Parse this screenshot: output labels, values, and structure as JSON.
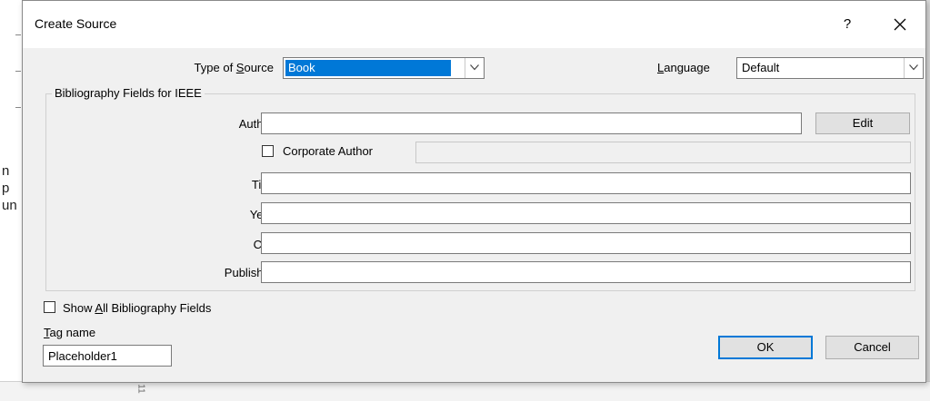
{
  "dialog": {
    "title": "Create Source",
    "help_label": "?",
    "close_label": "✕"
  },
  "source_type": {
    "label_pre": "Type of ",
    "label_mn": "S",
    "label_post": "ource",
    "value": "Book"
  },
  "language": {
    "label_mn": "L",
    "label_post": "anguage",
    "value": "Default"
  },
  "group": {
    "label": "Bibliography Fields for IEEE"
  },
  "fields": {
    "author_label": "Author",
    "author_value": "",
    "edit_label": "Edit",
    "corporate_label": "Corporate Author",
    "corporate_checked": false,
    "corporate_value": "",
    "title_label": "Title",
    "title_value": "",
    "year_label": "Year",
    "year_value": "",
    "city_label": "City",
    "city_value": "",
    "publisher_label": "Publisher",
    "publisher_value": ""
  },
  "show_all": {
    "label_pre": "Show ",
    "label_mn": "A",
    "label_post": "ll Bibliography Fields",
    "checked": false
  },
  "tag": {
    "label_mn": "T",
    "label_post": "ag name",
    "value": "Placeholder1"
  },
  "buttons": {
    "ok_label": "OK",
    "cancel_label": "Cancel"
  },
  "background_doc": {
    "fragments": [
      "n",
      "p",
      "un"
    ],
    "ruler_mark": "11"
  },
  "colors": {
    "selection": "#0078d7",
    "dialog_bg": "#f0f0f0"
  }
}
